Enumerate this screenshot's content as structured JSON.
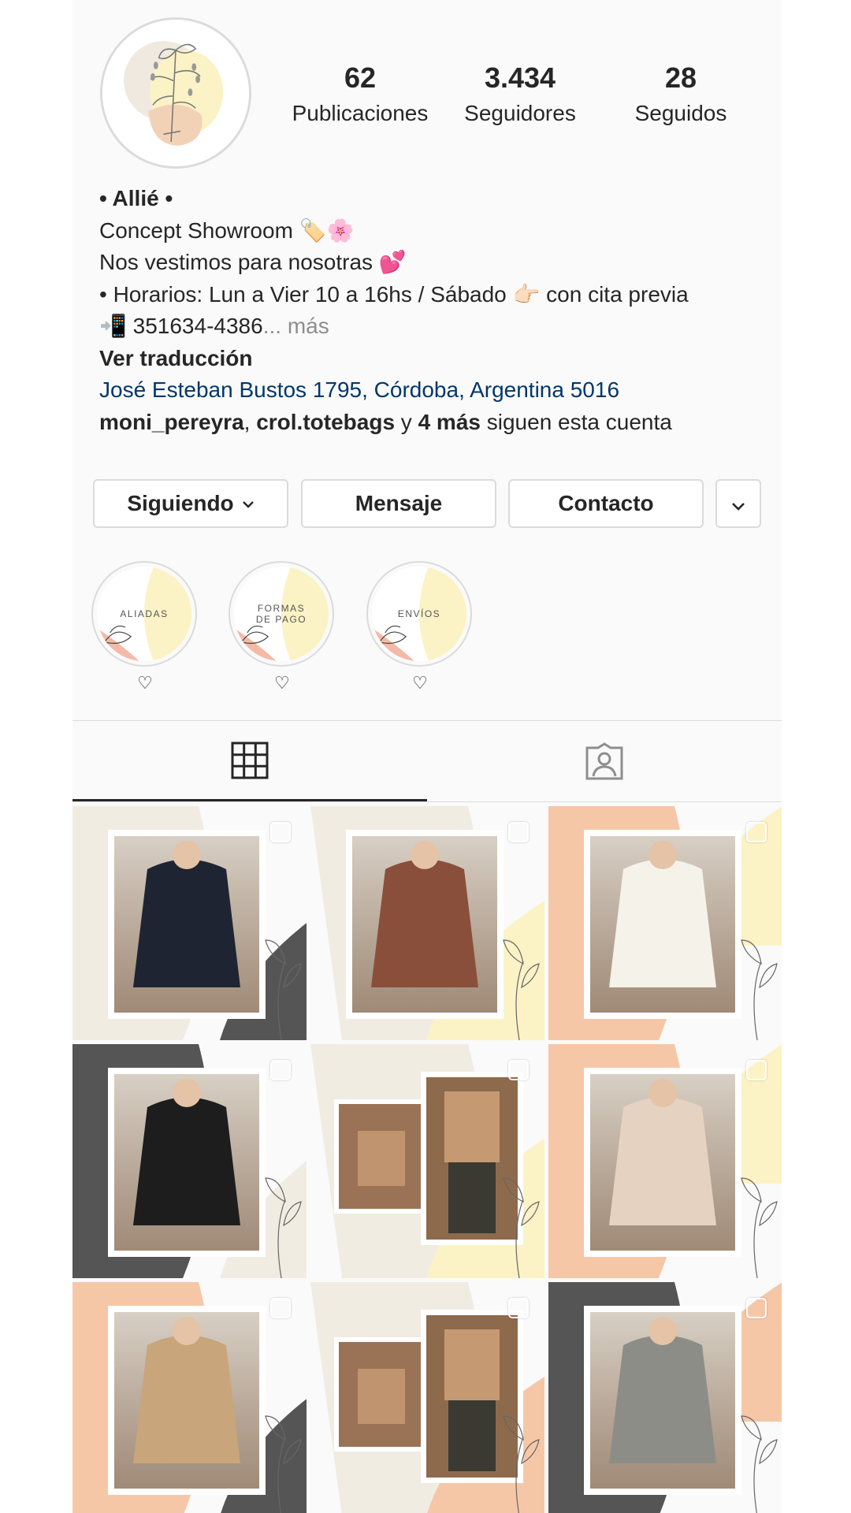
{
  "profile": {
    "stats": [
      {
        "value": "62",
        "label": "Publicaciones"
      },
      {
        "value": "3.434",
        "label": "Seguidores"
      },
      {
        "value": "28",
        "label": "Seguidos"
      }
    ],
    "name": "• Allié •",
    "bio_lines": [
      "Concept Showroom 🏷️🌸",
      "Nos vestimos para nosotras 💕",
      "• Horarios: Lun a Vier 10 a 16hs / Sábado 👉🏻 con cita previa",
      "📲 351634-4386"
    ],
    "more_label": "... más",
    "translate_label": "Ver traducción",
    "address": "José Esteban Bustos 1795, Córdoba, Argentina 5016",
    "followed_by": {
      "user1": "moni_pereyra",
      "sep": ", ",
      "user2": "crol.totebags",
      "and": " y ",
      "others": "4 más",
      "suffix": " siguen esta cuenta"
    }
  },
  "actions": {
    "following": "Siguiendo",
    "message": "Mensaje",
    "contact": "Contacto"
  },
  "highlights": [
    {
      "title": "ALIADAS",
      "caption": "♡"
    },
    {
      "title": "FORMAS DE PAGO",
      "caption": "♡"
    },
    {
      "title": "ENVÍOS",
      "caption": "♡"
    }
  ],
  "tabs": [
    {
      "icon": "grid-icon",
      "active": true
    },
    {
      "icon": "tagged-icon",
      "active": false
    }
  ],
  "colors": {
    "link": "#00376b",
    "border": "#dbdbdb",
    "peach": "#f6c7a7",
    "cream": "#f1ece2",
    "yellow": "#fbf3c5",
    "charcoal": "#555555"
  },
  "grid_posts": [
    {
      "bg": "cream",
      "accent": "charcoal",
      "cloth": "#1f2433"
    },
    {
      "bg": "cream",
      "accent": "yellow",
      "cloth": "#8a4f3a"
    },
    {
      "bg": "peach",
      "accent": "yellow",
      "cloth": "#f5f2ea"
    },
    {
      "bg": "charcoal",
      "accent": "cream",
      "cloth": "#1d1d1d"
    },
    {
      "bg": "cream",
      "accent": "yellow",
      "cloth": "#c59a73"
    },
    {
      "bg": "peach",
      "accent": "yellow",
      "cloth": "#e6d2c0"
    },
    {
      "bg": "peach",
      "accent": "charcoal",
      "cloth": "#c9a57c"
    },
    {
      "bg": "cream",
      "accent": "peach",
      "cloth": "#c59a73"
    },
    {
      "bg": "charcoal",
      "accent": "peach",
      "cloth": "#8d8d88"
    }
  ]
}
